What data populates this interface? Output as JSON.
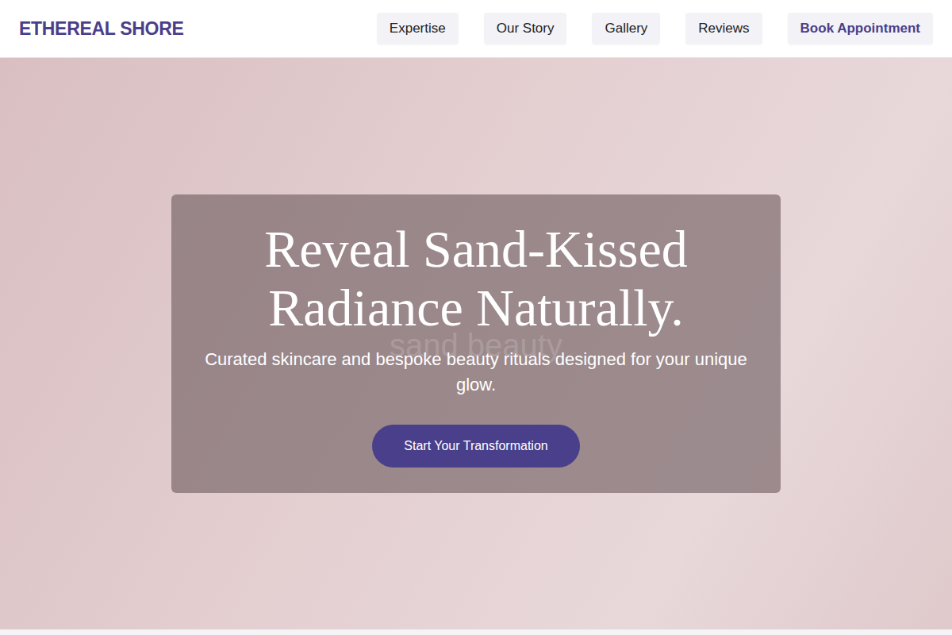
{
  "brand": {
    "name": "ETHEREAL SHORE"
  },
  "nav": [
    {
      "label": "Expertise",
      "kind": "link"
    },
    {
      "label": "Our Story",
      "kind": "link"
    },
    {
      "label": "Gallery",
      "kind": "link"
    },
    {
      "label": "Reviews",
      "kind": "link"
    },
    {
      "label": "Book Appointment",
      "kind": "cta"
    }
  ],
  "hero": {
    "title_lines": [
      "Reveal Sand-Kissed",
      "Radiance Naturally."
    ],
    "watermark": "sand beauty",
    "subtitle": "Curated skincare and bespoke beauty rituals designed for your unique glow.",
    "button": "Start Your Transformation"
  }
}
